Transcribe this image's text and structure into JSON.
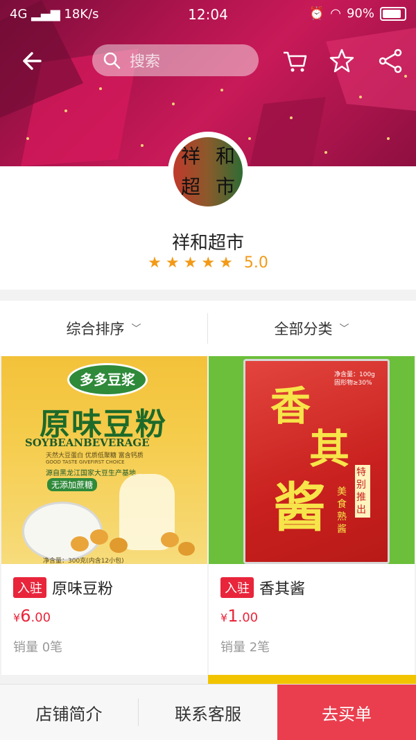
{
  "status_bar": {
    "network": "4G",
    "speed": "18K/s",
    "time": "12:04",
    "battery": "90%"
  },
  "search": {
    "placeholder": "搜索"
  },
  "store": {
    "logo_chars": [
      "祥",
      "和",
      "超",
      "市"
    ],
    "name": "祥和超市",
    "stars": 5,
    "rating": "5.0"
  },
  "filters": {
    "sort_label": "综合排序",
    "category_label": "全部分类"
  },
  "products": [
    {
      "tag": "入驻",
      "name": "原味豆粉",
      "currency": "¥",
      "price_int": "6",
      "price_dec": ".00",
      "sales": "销量 0笔",
      "package": {
        "brand": "多多豆浆",
        "title": "原味豆粉",
        "en": "SOYBEANBEVERAGE",
        "line1": "天然大豆蛋白 优质低聚糖 富含钙质",
        "line2": "GOOD TASTE GIVEFIRST CHOICE",
        "line3": "源自黑龙江国家大豆生产基地",
        "badge": "无添加蔗糖",
        "net": "净含量：300克(内含12小包)"
      }
    },
    {
      "tag": "入驻",
      "name": "香其酱",
      "currency": "¥",
      "price_int": "1",
      "price_dec": ".00",
      "sales": "销量 2笔",
      "package": {
        "big1": "香",
        "big2": "其",
        "big3": "酱",
        "spec1": "净含量：100g",
        "spec2": "固形物≥30%",
        "side1": "美食熟酱",
        "side2": "特别推出"
      }
    }
  ],
  "bottom_bar": {
    "intro_label": "店铺简介",
    "service_label": "联系客服",
    "buy_label": "去买单"
  },
  "colors": {
    "accent": "#e8253b",
    "star": "#f29a17",
    "banner": "#b0144e"
  }
}
